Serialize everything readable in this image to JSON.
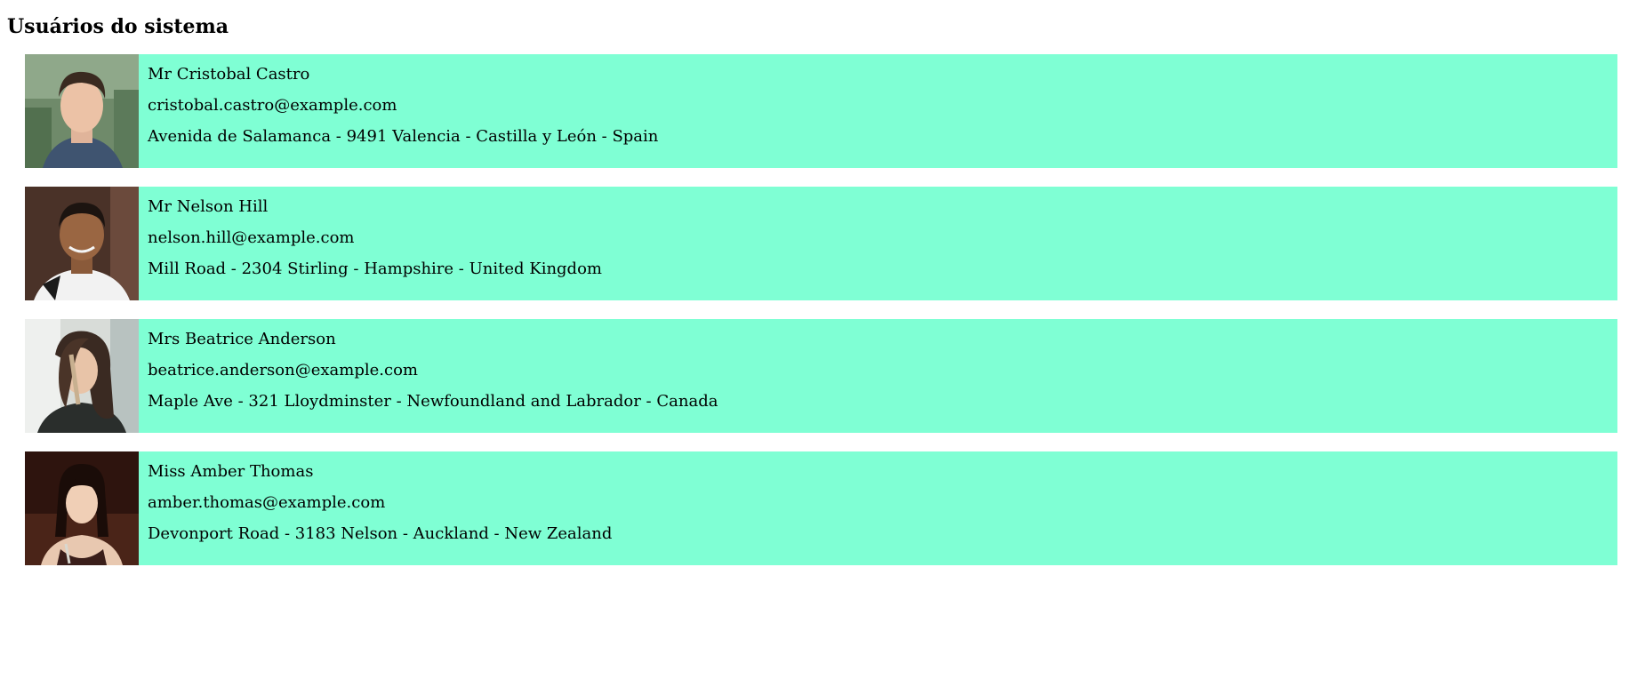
{
  "page": {
    "title": "Usuários do sistema"
  },
  "colors": {
    "card_background": "#7fffd4",
    "page_background": "#ffffff"
  },
  "users": [
    {
      "name": "Mr Cristobal Castro",
      "email": "cristobal.castro@example.com",
      "address": "Avenida de Salamanca - 9491 Valencia - Castilla y León - Spain",
      "photo_icon": "user-photo"
    },
    {
      "name": "Mr Nelson Hill",
      "email": "nelson.hill@example.com",
      "address": "Mill Road - 2304 Stirling - Hampshire - United Kingdom",
      "photo_icon": "user-photo"
    },
    {
      "name": "Mrs Beatrice Anderson",
      "email": "beatrice.anderson@example.com",
      "address": "Maple Ave - 321 Lloydminster - Newfoundland and Labrador - Canada",
      "photo_icon": "user-photo"
    },
    {
      "name": "Miss Amber Thomas",
      "email": "amber.thomas@example.com",
      "address": "Devonport Road - 3183 Nelson - Auckland - New Zealand",
      "photo_icon": "user-photo"
    }
  ]
}
